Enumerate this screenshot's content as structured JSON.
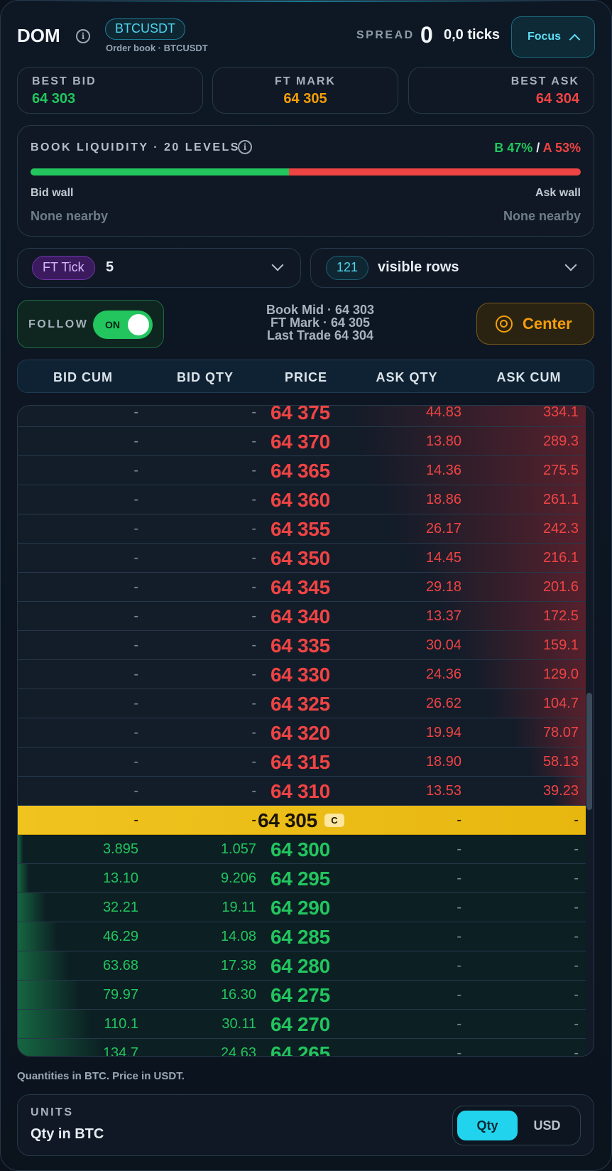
{
  "header": {
    "title": "DOM",
    "symbol": "BTCUSDT",
    "subtitle": "Order book · BTCUSDT",
    "spread_label": "SPREAD",
    "spread_value": "0",
    "spread_ticks": "0,0 ticks",
    "focus_label": "Focus"
  },
  "stats": {
    "best_bid": {
      "label": "BEST BID",
      "value": "64 303",
      "color": "#22c55e"
    },
    "ft_mark": {
      "label": "FT MARK",
      "value": "64 305",
      "color": "#f59e0b"
    },
    "best_ask": {
      "label": "BEST ASK",
      "value": "64 304",
      "color": "#ef4444"
    }
  },
  "liquidity": {
    "title": "BOOK LIQUIDITY · 20 LEVELS",
    "bid_ratio": "B 47%",
    "separator": "/",
    "ask_ratio": "A 53%",
    "bid_fraction": 0.47,
    "bid_wall_label": "Bid wall",
    "bid_wall_value": "None nearby",
    "ask_wall_label": "Ask wall",
    "ask_wall_value": "None nearby"
  },
  "controls": {
    "tick_pill": "FT Tick",
    "tick_value": "5",
    "rows_pill": "121",
    "rows_label": "visible rows",
    "follow_label": "FOLLOW",
    "follow_state": "ON",
    "book_mid": "Book Mid · 64 303",
    "ft_mark": "FT Mark · 64 305",
    "last_trade": "Last Trade 64 304",
    "center_label": "Center"
  },
  "table": {
    "headers": [
      "BID CUM",
      "BID QTY",
      "PRICE",
      "ASK QTY",
      "ASK CUM"
    ],
    "rows": [
      {
        "type": "ask",
        "bid_cum": "-",
        "bid_qty": "-",
        "price": "64 375",
        "ask_qty": "44.83",
        "ask_cum": "334.1",
        "depth": 0.42
      },
      {
        "type": "ask",
        "bid_cum": "-",
        "bid_qty": "-",
        "price": "64 370",
        "ask_qty": "13.80",
        "ask_cum": "289.3",
        "depth": 0.4
      },
      {
        "type": "ask",
        "bid_cum": "-",
        "bid_qty": "-",
        "price": "64 365",
        "ask_qty": "14.36",
        "ask_cum": "275.5",
        "depth": 0.38
      },
      {
        "type": "ask",
        "bid_cum": "-",
        "bid_qty": "-",
        "price": "64 360",
        "ask_qty": "18.86",
        "ask_cum": "261.1",
        "depth": 0.36
      },
      {
        "type": "ask",
        "bid_cum": "-",
        "bid_qty": "-",
        "price": "64 355",
        "ask_qty": "26.17",
        "ask_cum": "242.3",
        "depth": 0.34
      },
      {
        "type": "ask",
        "bid_cum": "-",
        "bid_qty": "-",
        "price": "64 350",
        "ask_qty": "14.45",
        "ask_cum": "216.1",
        "depth": 0.31
      },
      {
        "type": "ask",
        "bid_cum": "-",
        "bid_qty": "-",
        "price": "64 345",
        "ask_qty": "29.18",
        "ask_cum": "201.6",
        "depth": 0.29
      },
      {
        "type": "ask",
        "bid_cum": "-",
        "bid_qty": "-",
        "price": "64 340",
        "ask_qty": "13.37",
        "ask_cum": "172.5",
        "depth": 0.26
      },
      {
        "type": "ask",
        "bid_cum": "-",
        "bid_qty": "-",
        "price": "64 335",
        "ask_qty": "30.04",
        "ask_cum": "159.1",
        "depth": 0.23
      },
      {
        "type": "ask",
        "bid_cum": "-",
        "bid_qty": "-",
        "price": "64 330",
        "ask_qty": "24.36",
        "ask_cum": "129.0",
        "depth": 0.2
      },
      {
        "type": "ask",
        "bid_cum": "-",
        "bid_qty": "-",
        "price": "64 325",
        "ask_qty": "26.62",
        "ask_cum": "104.7",
        "depth": 0.17
      },
      {
        "type": "ask",
        "bid_cum": "-",
        "bid_qty": "-",
        "price": "64 320",
        "ask_qty": "19.94",
        "ask_cum": "78.07",
        "depth": 0.13
      },
      {
        "type": "ask",
        "bid_cum": "-",
        "bid_qty": "-",
        "price": "64 315",
        "ask_qty": "18.90",
        "ask_cum": "58.13",
        "depth": 0.1
      },
      {
        "type": "ask",
        "bid_cum": "-",
        "bid_qty": "-",
        "price": "64 310",
        "ask_qty": "13.53",
        "ask_cum": "39.23",
        "depth": 0.06
      },
      {
        "type": "mark",
        "bid_cum": "-",
        "bid_qty": "-",
        "price": "64 305",
        "badge": "C",
        "ask_qty": "-",
        "ask_cum": "-",
        "depth": 0
      },
      {
        "type": "bid",
        "bid_cum": "3.895",
        "bid_qty": "1.057",
        "price": "64 300",
        "ask_qty": "-",
        "ask_cum": "-",
        "depth": 0.01
      },
      {
        "type": "bid",
        "bid_cum": "13.10",
        "bid_qty": "9.206",
        "price": "64 295",
        "ask_qty": "-",
        "ask_cum": "-",
        "depth": 0.02
      },
      {
        "type": "bid",
        "bid_cum": "32.21",
        "bid_qty": "19.11",
        "price": "64 290",
        "ask_qty": "-",
        "ask_cum": "-",
        "depth": 0.05
      },
      {
        "type": "bid",
        "bid_cum": "46.29",
        "bid_qty": "14.08",
        "price": "64 285",
        "ask_qty": "-",
        "ask_cum": "-",
        "depth": 0.07
      },
      {
        "type": "bid",
        "bid_cum": "63.68",
        "bid_qty": "17.38",
        "price": "64 280",
        "ask_qty": "-",
        "ask_cum": "-",
        "depth": 0.09
      },
      {
        "type": "bid",
        "bid_cum": "79.97",
        "bid_qty": "16.30",
        "price": "64 275",
        "ask_qty": "-",
        "ask_cum": "-",
        "depth": 0.11
      },
      {
        "type": "bid",
        "bid_cum": "110.1",
        "bid_qty": "30.11",
        "price": "64 270",
        "ask_qty": "-",
        "ask_cum": "-",
        "depth": 0.13
      },
      {
        "type": "bid",
        "bid_cum": "134.7",
        "bid_qty": "24.63",
        "price": "64 265",
        "ask_qty": "-",
        "ask_cum": "-",
        "depth": 0.15
      }
    ]
  },
  "footer": {
    "note": "Quantities in BTC. Price in USDT.",
    "units_label": "UNITS",
    "units_value": "Qty in BTC",
    "qty_label": "Qty",
    "usd_label": "USD"
  }
}
